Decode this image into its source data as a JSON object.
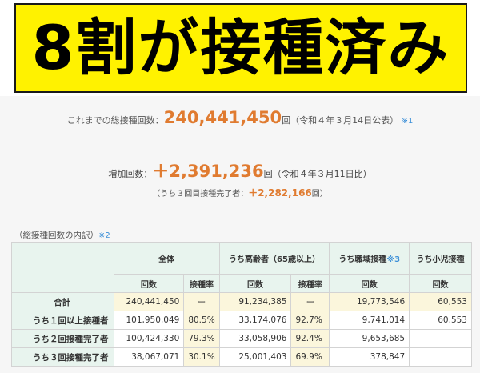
{
  "banner": {
    "title": "8割が接種済み"
  },
  "summary": {
    "total_label": "これまでの総接種回数：",
    "total_value": "240,441,450",
    "total_unit": "回",
    "total_note": "（令和４年３月14日公表）",
    "total_ref": "※1",
    "increase_label": "増加回数：",
    "increase_value": "＋2,391,236",
    "increase_unit": "回",
    "increase_note": "（令和４年３月11日比）",
    "third_label": "（うち３回目接種完了者：",
    "third_value": "＋2,282,166",
    "third_unit": "回）"
  },
  "breakdown": {
    "label": "（総接種回数の内訳）",
    "ref": "※2"
  },
  "table": {
    "groups": {
      "all": "全体",
      "elderly": "うち高齢者（65歳以上）",
      "workplace": "うち職域接種",
      "workplace_ref": "※3",
      "child": "うち小児接種"
    },
    "sub": {
      "count": "回数",
      "rate": "接種率"
    },
    "rows": [
      {
        "label": "合計",
        "all_count": "240,441,450",
        "all_rate": "ー",
        "elderly_count": "91,234,385",
        "elderly_rate": "ー",
        "workplace": "19,773,546",
        "child": "60,553"
      },
      {
        "label": "うち１回以上接種者",
        "all_count": "101,950,049",
        "all_rate": "80.5%",
        "elderly_count": "33,174,076",
        "elderly_rate": "92.7%",
        "workplace": "9,741,014",
        "child": "60,553"
      },
      {
        "label": "うち２回接種完了者",
        "all_count": "100,424,330",
        "all_rate": "79.3%",
        "elderly_count": "33,058,906",
        "elderly_rate": "92.4%",
        "workplace": "9,653,685",
        "child": ""
      },
      {
        "label": "うち３回接種完了者",
        "all_count": "38,067,071",
        "all_rate": "30.1%",
        "elderly_count": "25,001,403",
        "elderly_rate": "69.9%",
        "workplace": "378,847",
        "child": ""
      }
    ]
  },
  "colors": {
    "banner": "#fff200",
    "accent_orange": "#e07b30",
    "link_blue": "#3b8fd8",
    "header_green": "#e8f4ee",
    "highlight_yellow": "#fbf6dc"
  }
}
